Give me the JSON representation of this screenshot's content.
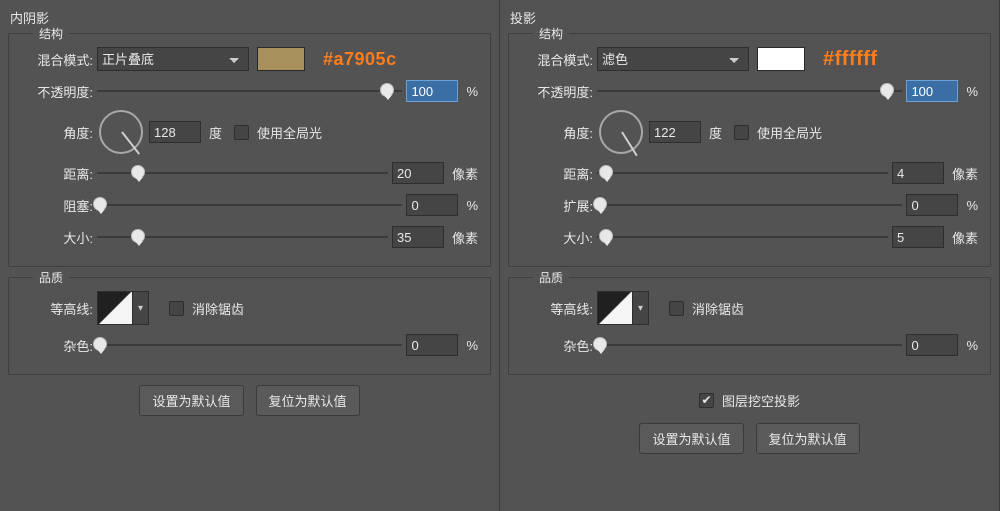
{
  "left": {
    "panel_title": "内阴影",
    "structure_legend": "结构",
    "blend_label": "混合模式:",
    "blend_value": "正片叠底",
    "swatch_color": "#a7905c",
    "annotation": "#a7905c",
    "opacity_label": "不透明度:",
    "opacity_value": "100",
    "opacity_unit": "%",
    "angle_label": "角度:",
    "angle_value": "128",
    "angle_unit": "度",
    "global_light_label": "使用全局光",
    "global_light_checked": false,
    "distance_label": "距离:",
    "distance_value": "20",
    "distance_unit": "像素",
    "choke_label": "阻塞:",
    "choke_value": "0",
    "choke_unit": "%",
    "size_label": "大小:",
    "size_value": "35",
    "size_unit": "像素",
    "quality_legend": "品质",
    "contour_label": "等高线:",
    "antialias_label": "消除锯齿",
    "antialias_checked": false,
    "noise_label": "杂色:",
    "noise_value": "0",
    "noise_unit": "%",
    "btn_default": "设置为默认值",
    "btn_reset": "复位为默认值"
  },
  "right": {
    "panel_title": "投影",
    "structure_legend": "结构",
    "blend_label": "混合模式:",
    "blend_value": "滤色",
    "swatch_color": "#ffffff",
    "annotation": "#ffffff",
    "opacity_label": "不透明度:",
    "opacity_value": "100",
    "opacity_unit": "%",
    "angle_label": "角度:",
    "angle_value": "122",
    "angle_unit": "度",
    "global_light_label": "使用全局光",
    "global_light_checked": false,
    "distance_label": "距离:",
    "distance_value": "4",
    "distance_unit": "像素",
    "spread_label": "扩展:",
    "spread_value": "0",
    "spread_unit": "%",
    "size_label": "大小:",
    "size_value": "5",
    "size_unit": "像素",
    "quality_legend": "品质",
    "contour_label": "等高线:",
    "antialias_label": "消除锯齿",
    "antialias_checked": false,
    "noise_label": "杂色:",
    "noise_value": "0",
    "noise_unit": "%",
    "knockout_label": "图层挖空投影",
    "knockout_checked": true,
    "btn_default": "设置为默认值",
    "btn_reset": "复位为默认值"
  }
}
